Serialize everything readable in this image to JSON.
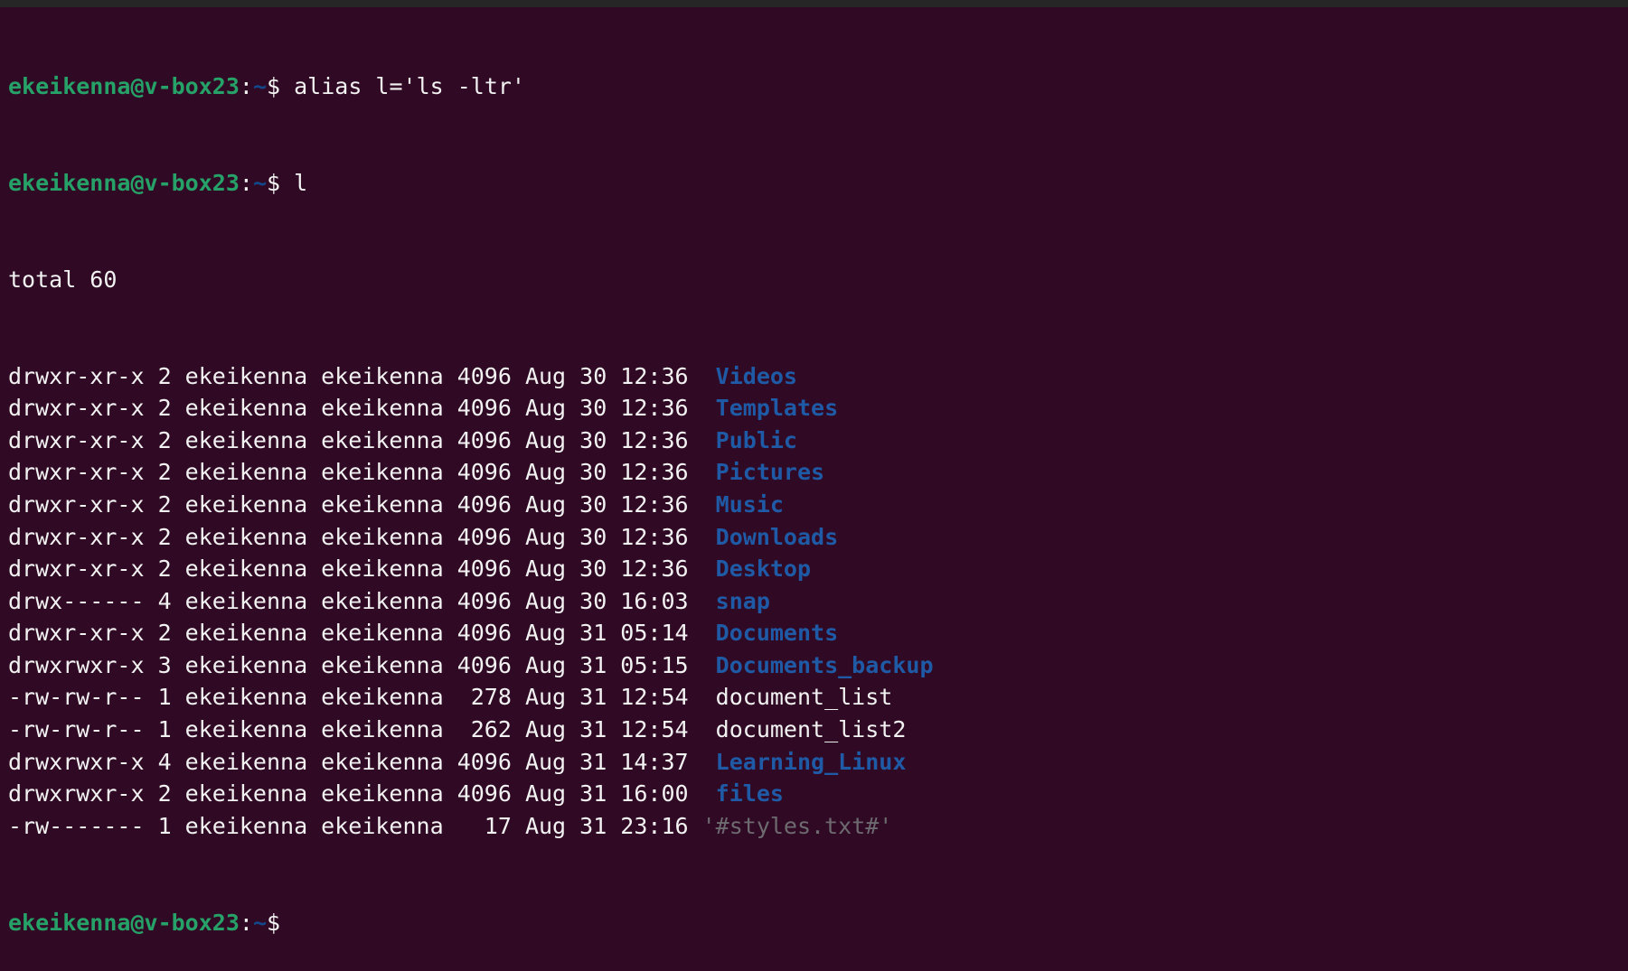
{
  "colors": {
    "background": "#300a24",
    "prompt_user": "#26a269",
    "prompt_path": "#12488b",
    "directory": "#1f5aa6",
    "quoted_file": "#6d6a70",
    "text": "#f2f2f2"
  },
  "prompt": {
    "user_host": "ekeikenna@v-box23",
    "colon": ":",
    "path": "~",
    "symbol": "$ "
  },
  "commands": [
    "alias l='ls -ltr'",
    "l"
  ],
  "total_line": "total 60",
  "listing": [
    {
      "meta": "drwxr-xr-x 2 ekeikenna ekeikenna 4096 Aug 30 12:36  ",
      "name": "Videos",
      "kind": "dir"
    },
    {
      "meta": "drwxr-xr-x 2 ekeikenna ekeikenna 4096 Aug 30 12:36  ",
      "name": "Templates",
      "kind": "dir"
    },
    {
      "meta": "drwxr-xr-x 2 ekeikenna ekeikenna 4096 Aug 30 12:36  ",
      "name": "Public",
      "kind": "dir"
    },
    {
      "meta": "drwxr-xr-x 2 ekeikenna ekeikenna 4096 Aug 30 12:36  ",
      "name": "Pictures",
      "kind": "dir"
    },
    {
      "meta": "drwxr-xr-x 2 ekeikenna ekeikenna 4096 Aug 30 12:36  ",
      "name": "Music",
      "kind": "dir"
    },
    {
      "meta": "drwxr-xr-x 2 ekeikenna ekeikenna 4096 Aug 30 12:36  ",
      "name": "Downloads",
      "kind": "dir"
    },
    {
      "meta": "drwxr-xr-x 2 ekeikenna ekeikenna 4096 Aug 30 12:36  ",
      "name": "Desktop",
      "kind": "dir"
    },
    {
      "meta": "drwx------ 4 ekeikenna ekeikenna 4096 Aug 30 16:03  ",
      "name": "snap",
      "kind": "dir"
    },
    {
      "meta": "drwxr-xr-x 2 ekeikenna ekeikenna 4096 Aug 31 05:14  ",
      "name": "Documents",
      "kind": "dir"
    },
    {
      "meta": "drwxrwxr-x 3 ekeikenna ekeikenna 4096 Aug 31 05:15  ",
      "name": "Documents_backup",
      "kind": "dir"
    },
    {
      "meta": "-rw-rw-r-- 1 ekeikenna ekeikenna  278 Aug 31 12:54  ",
      "name": "document_list",
      "kind": "file"
    },
    {
      "meta": "-rw-rw-r-- 1 ekeikenna ekeikenna  262 Aug 31 12:54  ",
      "name": "document_list2",
      "kind": "file"
    },
    {
      "meta": "drwxrwxr-x 4 ekeikenna ekeikenna 4096 Aug 31 14:37  ",
      "name": "Learning_Linux",
      "kind": "dir"
    },
    {
      "meta": "drwxrwxr-x 2 ekeikenna ekeikenna 4096 Aug 31 16:00  ",
      "name": "files",
      "kind": "dir"
    },
    {
      "meta": "-rw------- 1 ekeikenna ekeikenna   17 Aug 31 23:16 ",
      "name": "'#styles.txt#'",
      "kind": "quoted"
    }
  ]
}
